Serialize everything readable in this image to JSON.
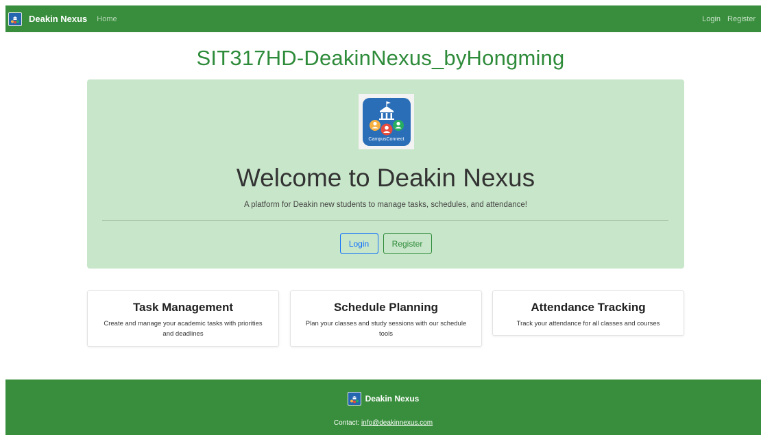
{
  "navbar": {
    "brand": "Deakin Nexus",
    "home": "Home",
    "login": "Login",
    "register": "Register",
    "color": "#388e3c"
  },
  "site_title": "SIT317HD-DeakinNexus_byHongming",
  "hero": {
    "logo_label": "CampusConnect",
    "title": "Welcome to Deakin Nexus",
    "subtitle": "A platform for Deakin new students to manage tasks, schedules, and attendance!",
    "login_label": "Login",
    "register_label": "Register",
    "background": "#c8e6c9"
  },
  "features": [
    {
      "title": "Task Management",
      "description": "Create and manage your academic tasks with priorities and deadlines"
    },
    {
      "title": "Schedule Planning",
      "description": "Plan your classes and study sessions with our schedule tools"
    },
    {
      "title": "Attendance Tracking",
      "description": "Track your attendance for all classes and courses"
    }
  ],
  "footer": {
    "brand": "Deakin Nexus",
    "contact_label": "Contact: ",
    "contact_email": "info@deakinnexus.com"
  }
}
